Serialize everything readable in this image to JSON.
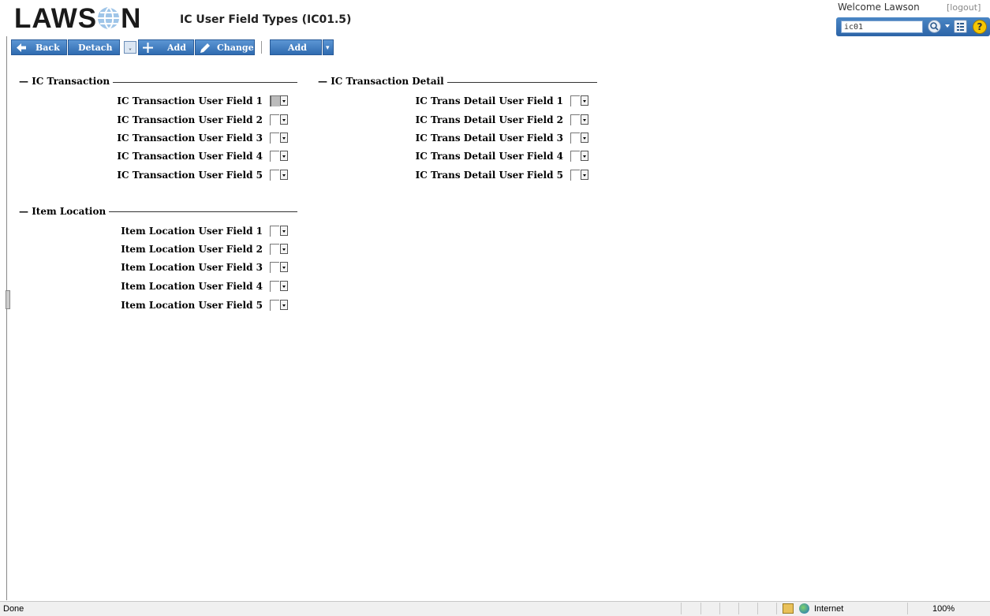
{
  "header": {
    "logo_text_left": "LAWS",
    "logo_text_right": "N",
    "title": "IC User Field Types (IC01.5)",
    "welcome": "Welcome Lawson",
    "logout": "[logout]",
    "search_value": "ic01",
    "help_glyph": "?"
  },
  "toolbar": {
    "back": "Back",
    "detach": "Detach",
    "mini_glyph": "ˬ",
    "add": "Add",
    "change": "Change",
    "add_menu": "Add",
    "add_menu_arrow": "▾"
  },
  "groups": {
    "ic_transaction": {
      "title": "IC Transaction",
      "fields": [
        "IC Transaction User Field 1",
        "IC Transaction User Field 2",
        "IC Transaction User Field 3",
        "IC Transaction User Field 4",
        "IC Transaction User Field 5"
      ]
    },
    "ic_transaction_detail": {
      "title": "IC Transaction Detail",
      "fields": [
        "IC Trans Detail User Field 1",
        "IC Trans Detail User Field 2",
        "IC Trans Detail User Field 3",
        "IC Trans Detail User Field 4",
        "IC Trans Detail User Field 5"
      ]
    },
    "item_location": {
      "title": "Item Location",
      "fields": [
        "Item Location User Field 1",
        "Item Location User Field 2",
        "Item Location User Field 3",
        "Item Location User Field 4",
        "Item Location User Field 5"
      ]
    }
  },
  "statusbar": {
    "left": "Done",
    "zone": "Internet",
    "zoom": "100%"
  },
  "colors": {
    "toolbar_blue": "#3c78bd",
    "search_bar_blue": "#2c64a7"
  }
}
